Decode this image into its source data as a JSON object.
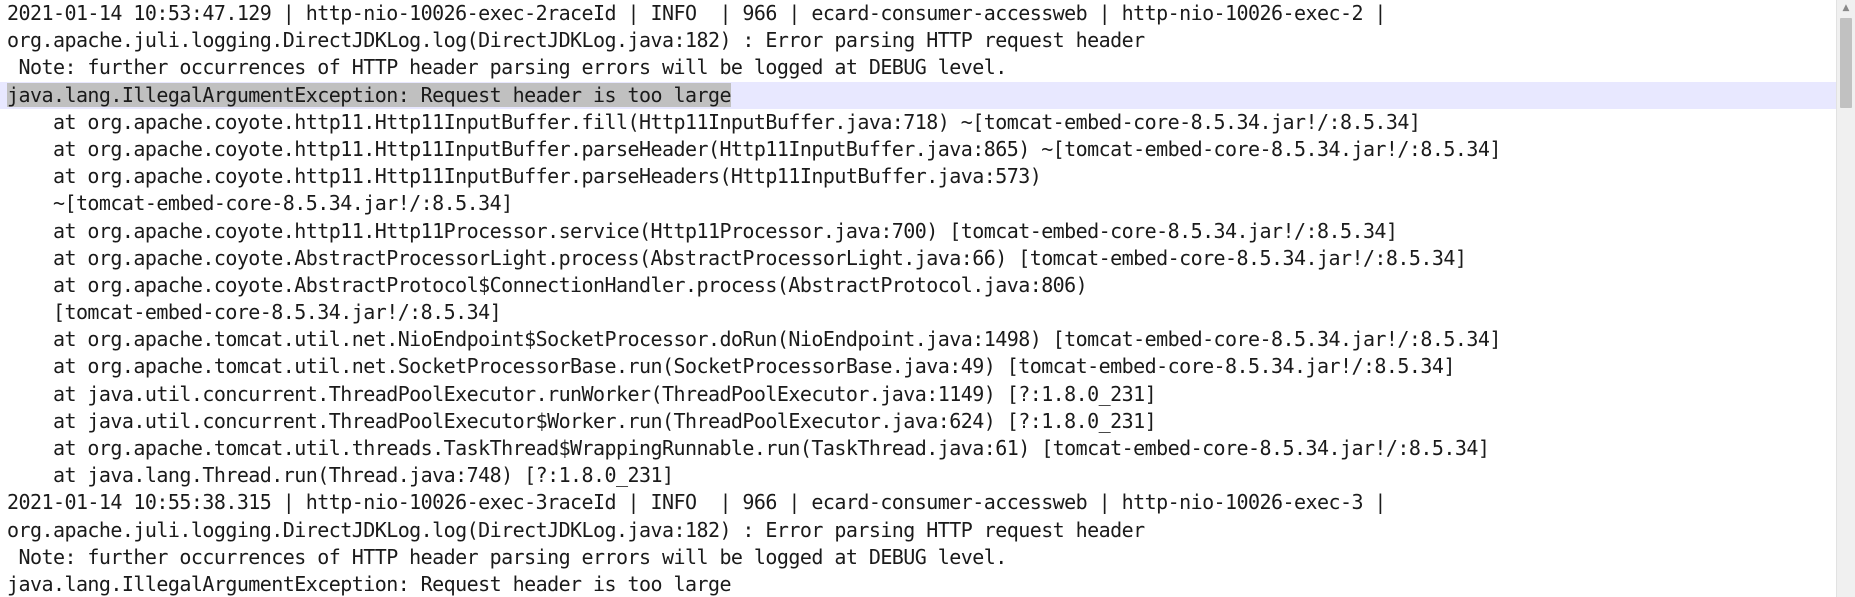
{
  "log": {
    "lines": [
      "2021-01-14 10:53:47.129 | http-nio-10026-exec-2raceId | INFO  | 966 | ecard-consumer-accessweb | http-nio-10026-exec-2 |",
      "org.apache.juli.logging.DirectJDKLog.log(DirectJDKLog.java:182) : Error parsing HTTP request header",
      " Note: further occurrences of HTTP header parsing errors will be logged at DEBUG level.",
      "java.lang.IllegalArgumentException: Request header is too large",
      "    at org.apache.coyote.http11.Http11InputBuffer.fill(Http11InputBuffer.java:718) ~[tomcat-embed-core-8.5.34.jar!/:8.5.34]",
      "    at org.apache.coyote.http11.Http11InputBuffer.parseHeader(Http11InputBuffer.java:865) ~[tomcat-embed-core-8.5.34.jar!/:8.5.34]",
      "    at org.apache.coyote.http11.Http11InputBuffer.parseHeaders(Http11InputBuffer.java:573)",
      "    ~[tomcat-embed-core-8.5.34.jar!/:8.5.34]",
      "    at org.apache.coyote.http11.Http11Processor.service(Http11Processor.java:700) [tomcat-embed-core-8.5.34.jar!/:8.5.34]",
      "    at org.apache.coyote.AbstractProcessorLight.process(AbstractProcessorLight.java:66) [tomcat-embed-core-8.5.34.jar!/:8.5.34]",
      "    at org.apache.coyote.AbstractProtocol$ConnectionHandler.process(AbstractProtocol.java:806)",
      "    [tomcat-embed-core-8.5.34.jar!/:8.5.34]",
      "    at org.apache.tomcat.util.net.NioEndpoint$SocketProcessor.doRun(NioEndpoint.java:1498) [tomcat-embed-core-8.5.34.jar!/:8.5.34]",
      "    at org.apache.tomcat.util.net.SocketProcessorBase.run(SocketProcessorBase.java:49) [tomcat-embed-core-8.5.34.jar!/:8.5.34]",
      "    at java.util.concurrent.ThreadPoolExecutor.runWorker(ThreadPoolExecutor.java:1149) [?:1.8.0_231]",
      "    at java.util.concurrent.ThreadPoolExecutor$Worker.run(ThreadPoolExecutor.java:624) [?:1.8.0_231]",
      "    at org.apache.tomcat.util.threads.TaskThread$WrappingRunnable.run(TaskThread.java:61) [tomcat-embed-core-8.5.34.jar!/:8.5.34]",
      "    at java.lang.Thread.run(Thread.java:748) [?:1.8.0_231]",
      "2021-01-14 10:55:38.315 | http-nio-10026-exec-3raceId | INFO  | 966 | ecard-consumer-accessweb | http-nio-10026-exec-3 |",
      "org.apache.juli.logging.DirectJDKLog.log(DirectJDKLog.java:182) : Error parsing HTTP request header",
      " Note: further occurrences of HTTP header parsing errors will be logged at DEBUG level.",
      "java.lang.IllegalArgumentException: Request header is too large"
    ],
    "highlighted_line_index": 3,
    "selected_text": "java.lang.IllegalArgumentException: Request header is too large"
  },
  "icons": {
    "scroll_up": "triangle-up"
  }
}
